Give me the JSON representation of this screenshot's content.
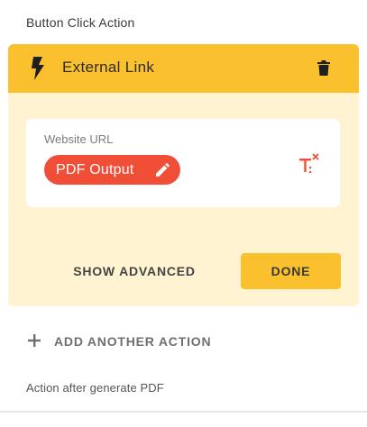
{
  "section_title": "Button Click Action",
  "action_card": {
    "title": "External Link",
    "header_icon": "bolt-icon",
    "delete_icon": "trash-icon",
    "url_field": {
      "label": "Website URL",
      "chip_label": "PDF Output",
      "chip_icon": "pencil-icon",
      "side_icon": "clear-format-icon"
    },
    "show_advanced_label": "SHOW ADVANCED",
    "done_label": "DONE"
  },
  "add_action": {
    "icon": "plus-icon",
    "label": "ADD ANOTHER ACTION"
  },
  "after_generate_title": "Action after generate PDF",
  "colors": {
    "accent": "#fbc02d",
    "card_background": "#fff3d1",
    "chip": "#f04e37"
  }
}
